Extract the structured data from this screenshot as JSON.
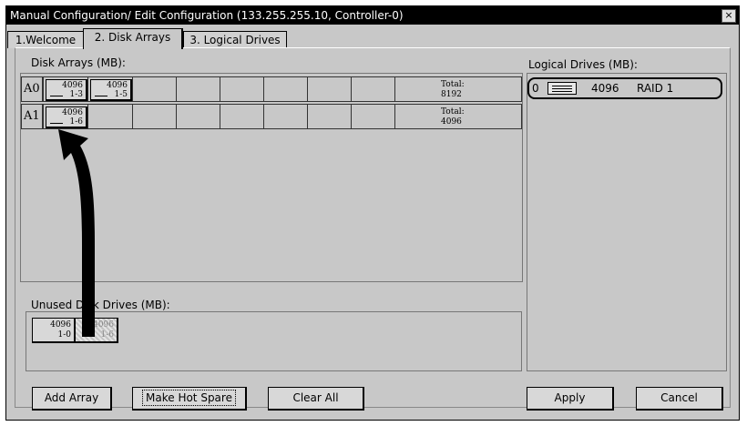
{
  "window": {
    "title": "Manual Configuration/ Edit Configuration (133.255.255.10, Controller-0)",
    "close_label": "×"
  },
  "tabs": [
    {
      "label": "1.Welcome"
    },
    {
      "label": "2. Disk Arrays"
    },
    {
      "label": "3. Logical Drives"
    }
  ],
  "disk_arrays": {
    "label": "Disk Arrays (MB):",
    "rows": [
      {
        "name": "A0",
        "drives": [
          {
            "size": "4096",
            "id": "1-3"
          },
          {
            "size": "4096",
            "id": "1-5"
          }
        ],
        "total_label": "Total:",
        "total": "8192"
      },
      {
        "name": "A1",
        "drives": [
          {
            "size": "4096",
            "id": "1-6"
          }
        ],
        "total_label": "Total:",
        "total": "4096"
      }
    ]
  },
  "unused": {
    "label": "Unused Disk Drives (MB):",
    "drives": [
      {
        "size": "4096",
        "id": "1-0"
      },
      {
        "size": "4096",
        "id": "1-6"
      }
    ]
  },
  "logical_drives": {
    "label": "Logical Drives (MB):",
    "items": [
      {
        "index": "0",
        "size": "4096",
        "raid": "RAID 1"
      }
    ]
  },
  "buttons": {
    "add_array": "Add Array",
    "make_hot_spare": "Make Hot Spare",
    "clear_all": "Clear All",
    "apply": "Apply",
    "cancel": "Cancel"
  }
}
